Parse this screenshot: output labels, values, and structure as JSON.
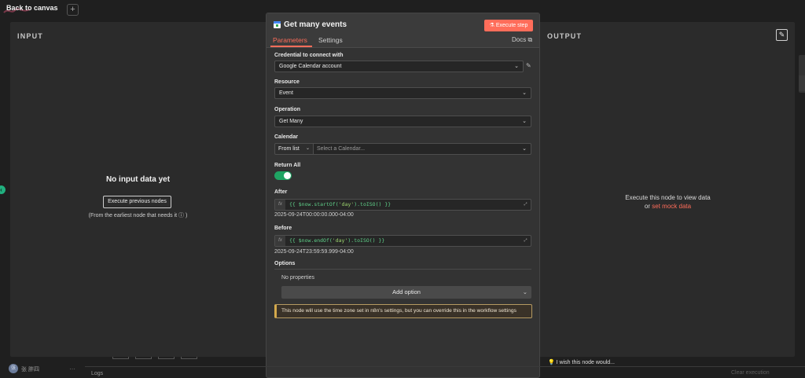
{
  "topbar": {
    "back_label": "Back to canvas",
    "plus_label": "+"
  },
  "input_panel": {
    "title": "INPUT",
    "empty_title": "No input data yet",
    "execute_previous": "Execute previous nodes",
    "earliest_note": "(From the earliest node that needs it",
    "earliest_note_end": ")"
  },
  "output_panel": {
    "title": "OUTPUT",
    "execute_hint": "Execute this node to view data",
    "or_text": "or",
    "mock_link": "set mock data"
  },
  "node": {
    "title": "Get many events",
    "execute_step": "Execute step",
    "tabs": {
      "parameters": "Parameters",
      "settings": "Settings",
      "docs": "Docs"
    },
    "credential": {
      "label": "Credential to connect with",
      "value": "Google Calendar account"
    },
    "resource": {
      "label": "Resource",
      "value": "Event"
    },
    "operation": {
      "label": "Operation",
      "value": "Get Many"
    },
    "calendar": {
      "label": "Calendar",
      "mode": "From list",
      "placeholder": "Select a Calendar..."
    },
    "return_all": {
      "label": "Return All",
      "enabled": true
    },
    "after": {
      "label": "After",
      "expr_open": "{{ ",
      "expr_body": "$now.startOf(",
      "expr_str": "'day'",
      "expr_tail": ").toISO() }}",
      "result": "2025-09-24T00:00:00.000-04:00"
    },
    "before": {
      "label": "Before",
      "expr_open": "{{ ",
      "expr_body": "$now.endOf(",
      "expr_str": "'day'",
      "expr_tail": ").toISO() }}",
      "result": "2025-09-24T23:59:59.999-04:00"
    },
    "options": {
      "label": "Options",
      "empty": "No properties",
      "add_option": "Add option"
    },
    "notice": "This node will use the time zone set in n8n's settings, but you can override this in the workflow settings",
    "fx_label": "fx"
  },
  "bottom": {
    "user_initials": "张",
    "username": "张 胖四",
    "logs_label": "Logs",
    "wish_label": "I wish this node would...",
    "clear_execution": "Clear execution"
  },
  "colors": {
    "accent": "#ff6d5a",
    "toggle_on": "#1fa463",
    "code_green": "#5fd089",
    "notice_border": "#d4a94c"
  }
}
